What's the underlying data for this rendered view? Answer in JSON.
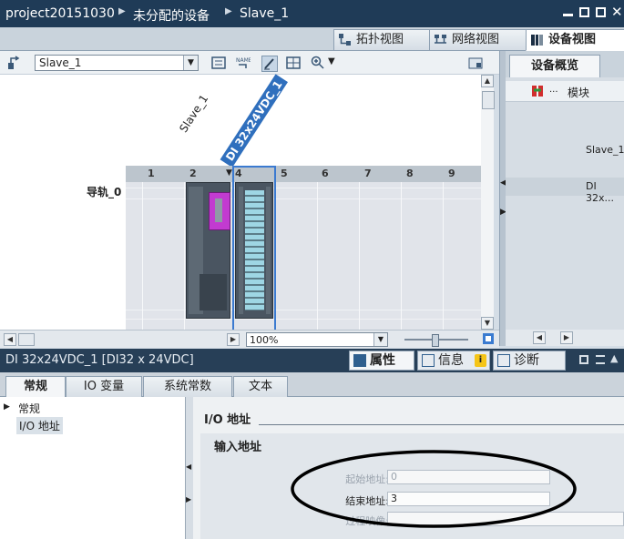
{
  "titlebar": {
    "project": "project20151030",
    "folder": "未分配的设备",
    "device": "Slave_1"
  },
  "view_tabs": [
    {
      "label": "拓扑视图",
      "icon": "topology-view-icon"
    },
    {
      "label": "网络视图",
      "icon": "network-view-icon"
    },
    {
      "label": "设备视图",
      "icon": "device-view-icon",
      "active": true
    }
  ],
  "toolbar": {
    "device_select": "Slave_1",
    "zoom": "100%"
  },
  "canvas": {
    "station_label": "Slave_1",
    "module_label": "DI 32x24VDC_1",
    "rail_label": "导轨_0",
    "slots": [
      "1",
      "2",
      "4",
      "5",
      "6",
      "7",
      "8",
      "9"
    ]
  },
  "overview": {
    "tab": "设备概览",
    "col_header": "模块",
    "col_ellipsis": "...",
    "rows": [
      "Slave_1",
      "DI 32x..."
    ]
  },
  "inspector": {
    "title": "DI 32x24VDC_1 [DI32 x 24VDC]",
    "panel_tabs": [
      {
        "label": "属性",
        "icon": "properties-icon"
      },
      {
        "label": "信息",
        "icon": "info-icon"
      },
      {
        "label": "诊断",
        "icon": "diagnostics-icon"
      }
    ],
    "tabs": [
      "常规",
      "IO 变量",
      "系统常数",
      "文本"
    ],
    "tree": [
      {
        "label": "常规",
        "has_arrow": true
      },
      {
        "label": "I/O 地址",
        "selected": true
      }
    ],
    "section_title": "I/O 地址",
    "group_title": "输入地址",
    "fields": [
      {
        "label": "起始地址:",
        "value": "0",
        "enabled": false
      },
      {
        "label": "结束地址:",
        "value": "3",
        "enabled": true
      },
      {
        "label": "过程映像:",
        "value": "",
        "enabled": false
      }
    ]
  }
}
